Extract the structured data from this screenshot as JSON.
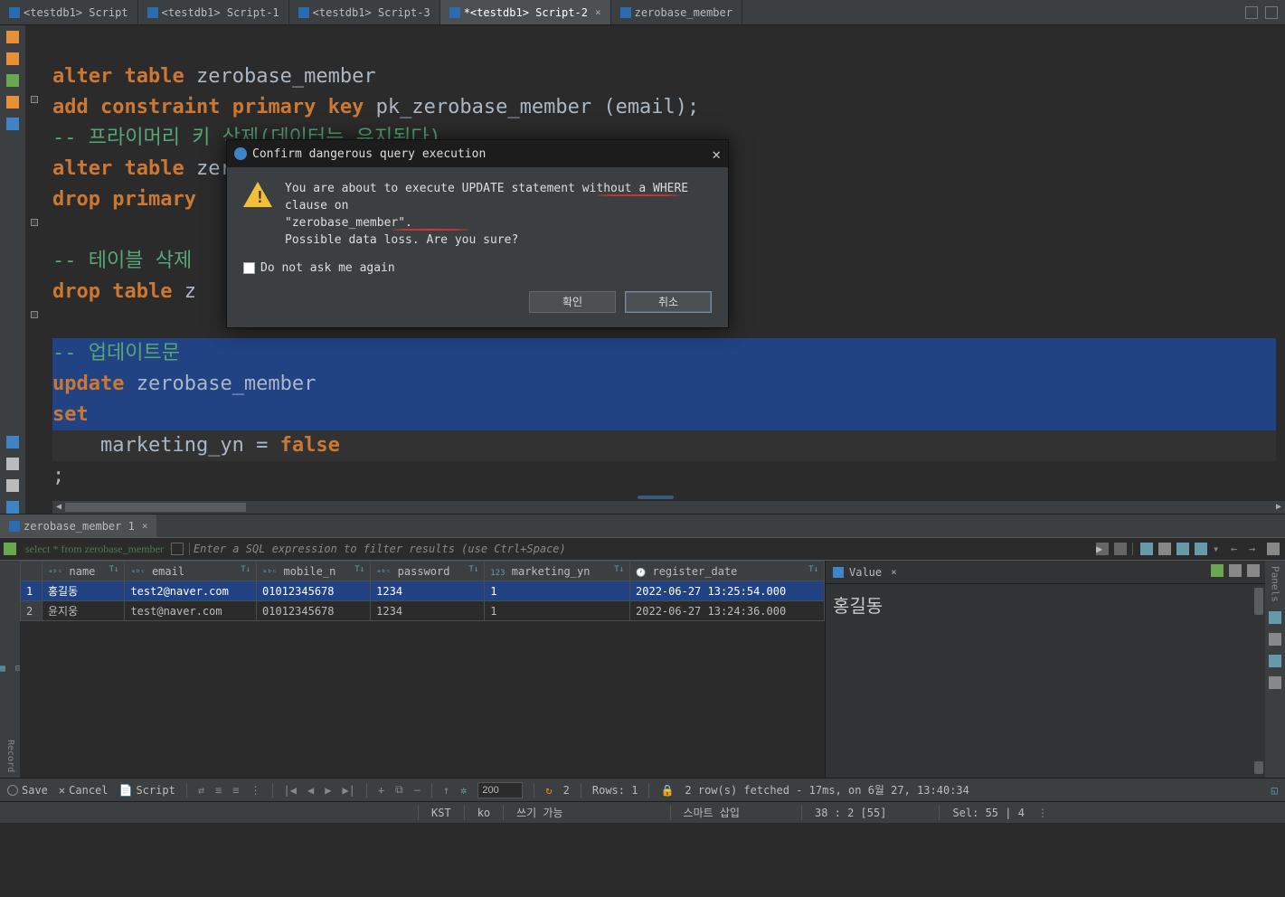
{
  "tabs": [
    {
      "label": "<testdb1> Script"
    },
    {
      "label": "<testdb1> Script-1"
    },
    {
      "label": "<testdb1> Script-3"
    },
    {
      "label": "*<testdb1> Script-2"
    },
    {
      "label": "zerobase_member"
    }
  ],
  "editor": {
    "line1_kw1": "alter",
    "line1_kw2": "table",
    "line1_id": "zerobase_member",
    "line2_kw1": "add",
    "line2_kw2": "constraint",
    "line2_kw3": "primary",
    "line2_kw4": "key",
    "line2_rest": " pk_zerobase_member (email);",
    "line3_cm": "-- 프라이머리 키 삭제(데이터는 유지된다)",
    "line4_kw1": "alter",
    "line4_kw2": "table",
    "line4_id": "zerobase_member",
    "line5_kw1": "drop",
    "line5_kw2": "primary",
    "line6_cm": "-- 테이블 삭제",
    "line7_kw1": "drop",
    "line7_kw2": "table",
    "line7_id": "z",
    "line8_cm": "-- 업데이트문",
    "line9_kw": "update",
    "line9_id": " zerobase_member",
    "line10_kw": "set",
    "line11_id": "    marketing_yn = ",
    "line11_kw": "false",
    "line12": ";"
  },
  "dialog": {
    "title": "Confirm dangerous query execution",
    "msg1": "You are about to execute UPDATE statement without a WHERE clause on",
    "msg2": "\"zerobase_member\".",
    "msg3": "Possible data loss. Are you sure?",
    "checkbox": "Do not ask me again",
    "ok": "확인",
    "cancel": "취소"
  },
  "results_tab": "zerobase_member 1",
  "filter": {
    "sql": "select * from zerobase_member",
    "placeholder": "Enter a SQL expression to filter results (use Ctrl+Space)"
  },
  "grid": {
    "headers": [
      "",
      "name",
      "email",
      "mobile_n",
      "password",
      "marketing_yn",
      "register_date"
    ],
    "rows": [
      {
        "n": "1",
        "name": "홍길동",
        "email": "test2@naver.com",
        "mobile": "01012345678",
        "password": "1234",
        "marketing": "1",
        "date": "2022-06-27 13:25:54.000"
      },
      {
        "n": "2",
        "name": "윤지웅",
        "email": "test@naver.com",
        "mobile": "01012345678",
        "password": "1234",
        "marketing": "1",
        "date": "2022-06-27 13:24:36.000"
      }
    ]
  },
  "value_panel": {
    "title": "Value",
    "content": "홍길동"
  },
  "right_label": "Panels",
  "left_grid_label": "Record",
  "bottom_toolbar": {
    "save": "Save",
    "cancel": "Cancel",
    "script": "Script",
    "page_size": "200",
    "refresh": "2",
    "rows": "Rows: 1",
    "fetch_msg": "2 row(s) fetched - 17ms, on 6월 27, 13:40:34"
  },
  "status_bar": {
    "tz": "KST",
    "lang": "ko",
    "write": "쓰기 가능",
    "insert": "스마트 삽입",
    "pos": "38 : 2 [55]",
    "sel": "Sel: 55 | 4"
  }
}
